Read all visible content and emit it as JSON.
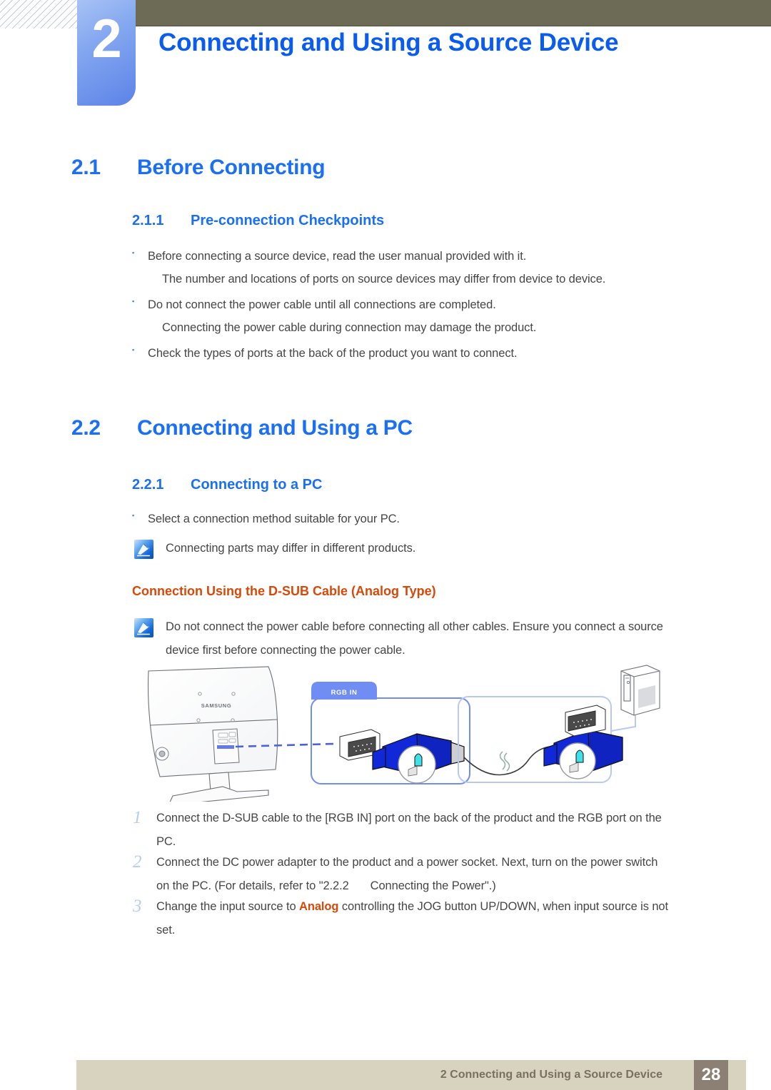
{
  "header": {
    "chapter_number": "2",
    "chapter_title": "Connecting and Using a Source Device"
  },
  "sections": {
    "s21": {
      "number": "2.1",
      "title": "Before Connecting",
      "sub": {
        "number": "2.1.1",
        "title": "Pre-connection Checkpoints"
      },
      "bullets": [
        "Before connecting a source device, read the user manual provided with it.",
        "Do not connect the power cable until all connections are completed.",
        "Check the types of ports at the back of the product you want to connect."
      ],
      "sub_lines": [
        "The number and locations of ports on source devices may differ from device to device.",
        "Connecting the power cable during connection may damage the product."
      ]
    },
    "s22": {
      "number": "2.2",
      "title": "Connecting and Using a PC",
      "sub": {
        "number": "2.2.1",
        "title": "Connecting to a PC"
      },
      "bullets": [
        "Select a connection method suitable for your PC."
      ],
      "note1": "Connecting parts may differ in different products.",
      "dsub_heading": "Connection Using the D-SUB Cable (Analog Type)",
      "note2_line1": "Do not connect the power cable before connecting all other cables. Ensure you connect a source",
      "note2_line2": "device first before connecting the power cable.",
      "steps": [
        {
          "number": "1",
          "line1": "Connect the D-SUB cable to the [RGB IN] port on the back of the product and the RGB port on the",
          "line2": "PC."
        },
        {
          "number": "2",
          "line1": "Connect the DC power adapter to the product and a power socket. Next, turn on the power switch",
          "line2_pre": "on the PC. (For details, refer to \"2.2.2",
          "line2_post": "Connecting the Power\".)"
        },
        {
          "number": "3",
          "line1_pre": "Change the input source to ",
          "line1_hl": "Analog",
          "line1_post": " controlling the JOG button UP/DOWN, when input source is not",
          "line2": "set."
        }
      ]
    }
  },
  "figure": {
    "monitor_brand": "SAMSUNG",
    "port_label": "RGB IN"
  },
  "footer": {
    "text": "2 Connecting and Using a Source Device",
    "page": "28"
  },
  "colors": {
    "heading_blue": "#1a6ff5",
    "title_blue": "#0a5bf0",
    "orange": "#d94808",
    "olive": "#6d6a55",
    "footer_band": "#d8d3bf",
    "footer_page_box": "#8c7f73",
    "body_gray": "#464646",
    "callout_blue": "#6f8df2",
    "connector_blue": "#1028d8"
  }
}
